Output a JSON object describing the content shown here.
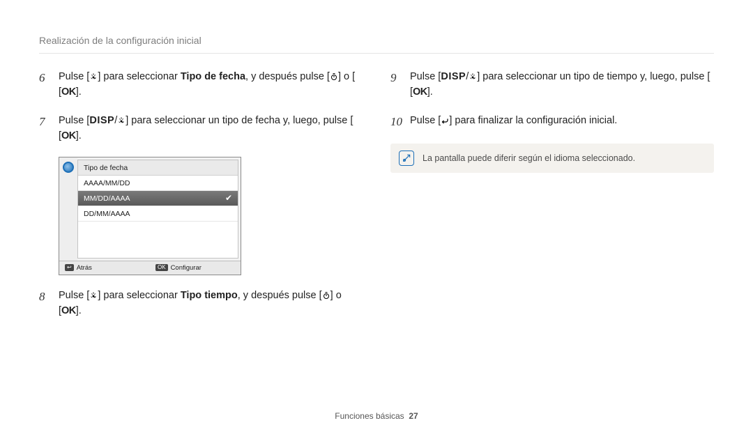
{
  "section_title": "Realización de la configuración inicial",
  "steps": {
    "s6": {
      "num": "6",
      "pre": "Pulse [",
      "after_icon": "] para seleccionar ",
      "bold": "Tipo de fecha",
      "mid": ", y después pulse [",
      "mid2": "] o [",
      "ok": "OK",
      "end": "]."
    },
    "s7": {
      "num": "7",
      "pre": "Pulse [",
      "disp": "DISP",
      "slash": "/",
      "after_icon": "] para seleccionar un tipo de fecha y, luego, pulse [",
      "ok": "OK",
      "end": "]."
    },
    "s8": {
      "num": "8",
      "pre": "Pulse [",
      "after_icon": "] para seleccionar ",
      "bold": "Tipo tiempo",
      "mid": ", y después pulse [",
      "mid2": "] o [",
      "ok": "OK",
      "end": "]."
    },
    "s9": {
      "num": "9",
      "pre": "Pulse [",
      "disp": "DISP",
      "slash": "/",
      "after_icon": "] para seleccionar un tipo de tiempo y, luego, pulse [",
      "ok": "OK",
      "end": "]."
    },
    "s10": {
      "num": "10",
      "pre": "Pulse [",
      "after_icon": "] para finalizar la configuración inicial."
    }
  },
  "menu": {
    "header": "Tipo de fecha",
    "opt1": "AAAA/MM/DD",
    "opt2": "MM/DD/AAAA",
    "opt3": "DD/MM/AAAA",
    "back_label": "Atrás",
    "ok_key": "OK",
    "set_label": "Configurar"
  },
  "note": {
    "text": "La pantalla puede diferir según el idioma seleccionado."
  },
  "footer": {
    "section": "Funciones básicas",
    "page": "27"
  }
}
